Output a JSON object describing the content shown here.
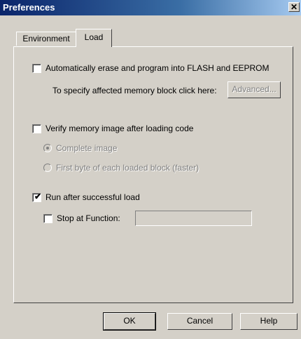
{
  "window": {
    "title": "Preferences",
    "close_glyph": "✕"
  },
  "tabs": [
    {
      "label": "Environment",
      "active": false
    },
    {
      "label": "Load",
      "active": true
    }
  ],
  "load": {
    "auto_erase": {
      "label": "Automatically erase and program into FLASH and EEPROM",
      "checked": false
    },
    "memory_block_hint": "To specify affected memory block click here:",
    "advanced_button": "Advanced...",
    "verify": {
      "label": "Verify memory image after loading code",
      "checked": false
    },
    "verify_options": [
      {
        "label": "Complete image",
        "selected": true,
        "enabled": false
      },
      {
        "label": "First byte of each loaded block (faster)",
        "selected": false,
        "enabled": false
      }
    ],
    "run_after_load": {
      "label": "Run after successful load",
      "checked": true
    },
    "stop_at_function": {
      "label": "Stop at Function:",
      "checked": false,
      "value": ""
    }
  },
  "buttons": {
    "ok": "OK",
    "cancel": "Cancel",
    "help": "Help"
  }
}
